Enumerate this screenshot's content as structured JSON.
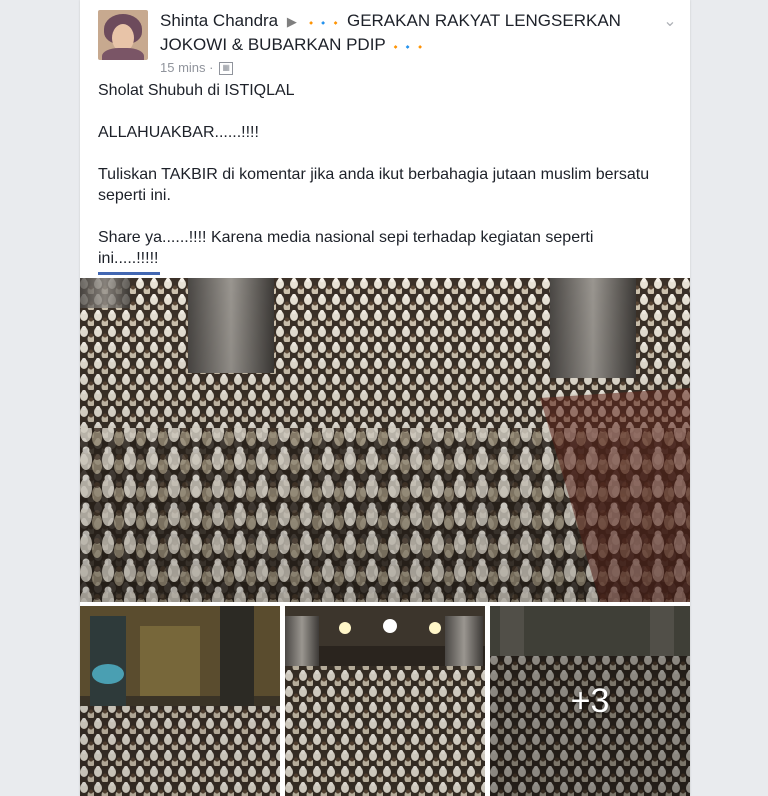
{
  "post": {
    "author": "Shinta Chandra",
    "separator": "▶",
    "group_prefix_icons": "🔸🔹🔸",
    "group_name": "GERAKAN RAKYAT LENGSERKAN JOKOWI & BUBARKAN PDIP",
    "group_suffix_icons": "🔸🔹🔸",
    "time": "15 mins",
    "dot": "·",
    "privacy_icon": "group-icon",
    "lines": [
      "Sholat Shubuh di ISTIQLAL",
      "ALLAHUAKBAR......!!!!",
      "Tuliskan TAKBIR di komentar jika anda ikut berbahagia jutaan muslim bersatu seperti ini.",
      "Share ya......!!!! Karena media nasional sepi terhadap kegiatan seperti ini.....!!!!!"
    ]
  },
  "photos": {
    "more_count_label": "+3"
  },
  "colors": {
    "accent": "#4267b2",
    "meta": "#90949c",
    "text": "#1d2129"
  }
}
